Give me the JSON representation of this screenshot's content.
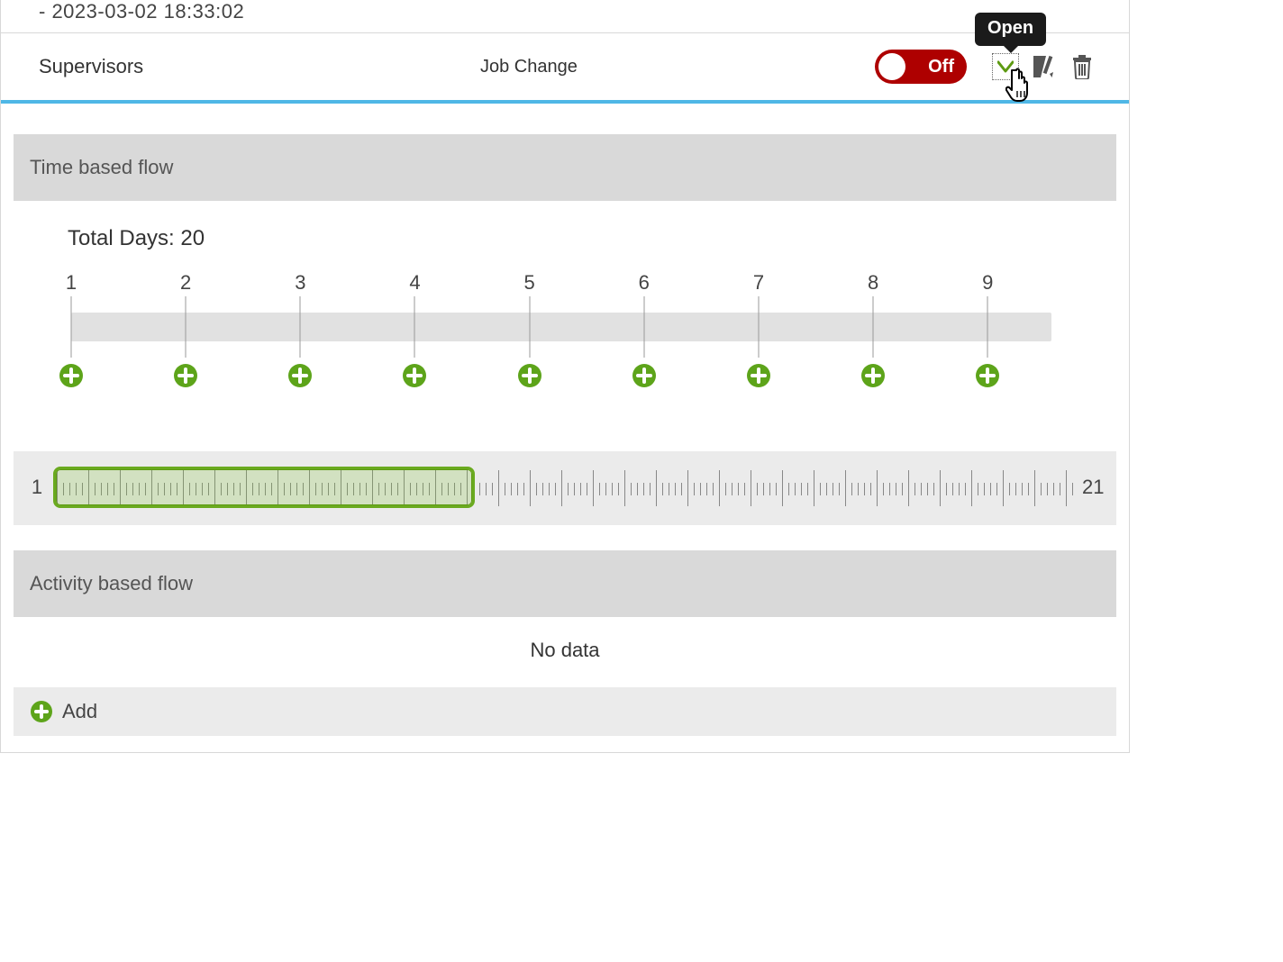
{
  "prev_row": {
    "timestamp": "- 2023-03-02 18:33:02"
  },
  "row": {
    "name": "Supervisors",
    "type": "Job Change",
    "toggle_label": "Off",
    "tooltip": "Open"
  },
  "time_flow": {
    "title": "Time based flow",
    "total_days_label": "Total Days: 20",
    "ticks": [
      "1",
      "2",
      "3",
      "4",
      "5",
      "6",
      "7",
      "8",
      "9"
    ],
    "ruler_start": "1",
    "ruler_end": "21",
    "range_percent": 41.5
  },
  "activity_flow": {
    "title": "Activity based flow",
    "empty": "No data",
    "add_label": "Add"
  }
}
